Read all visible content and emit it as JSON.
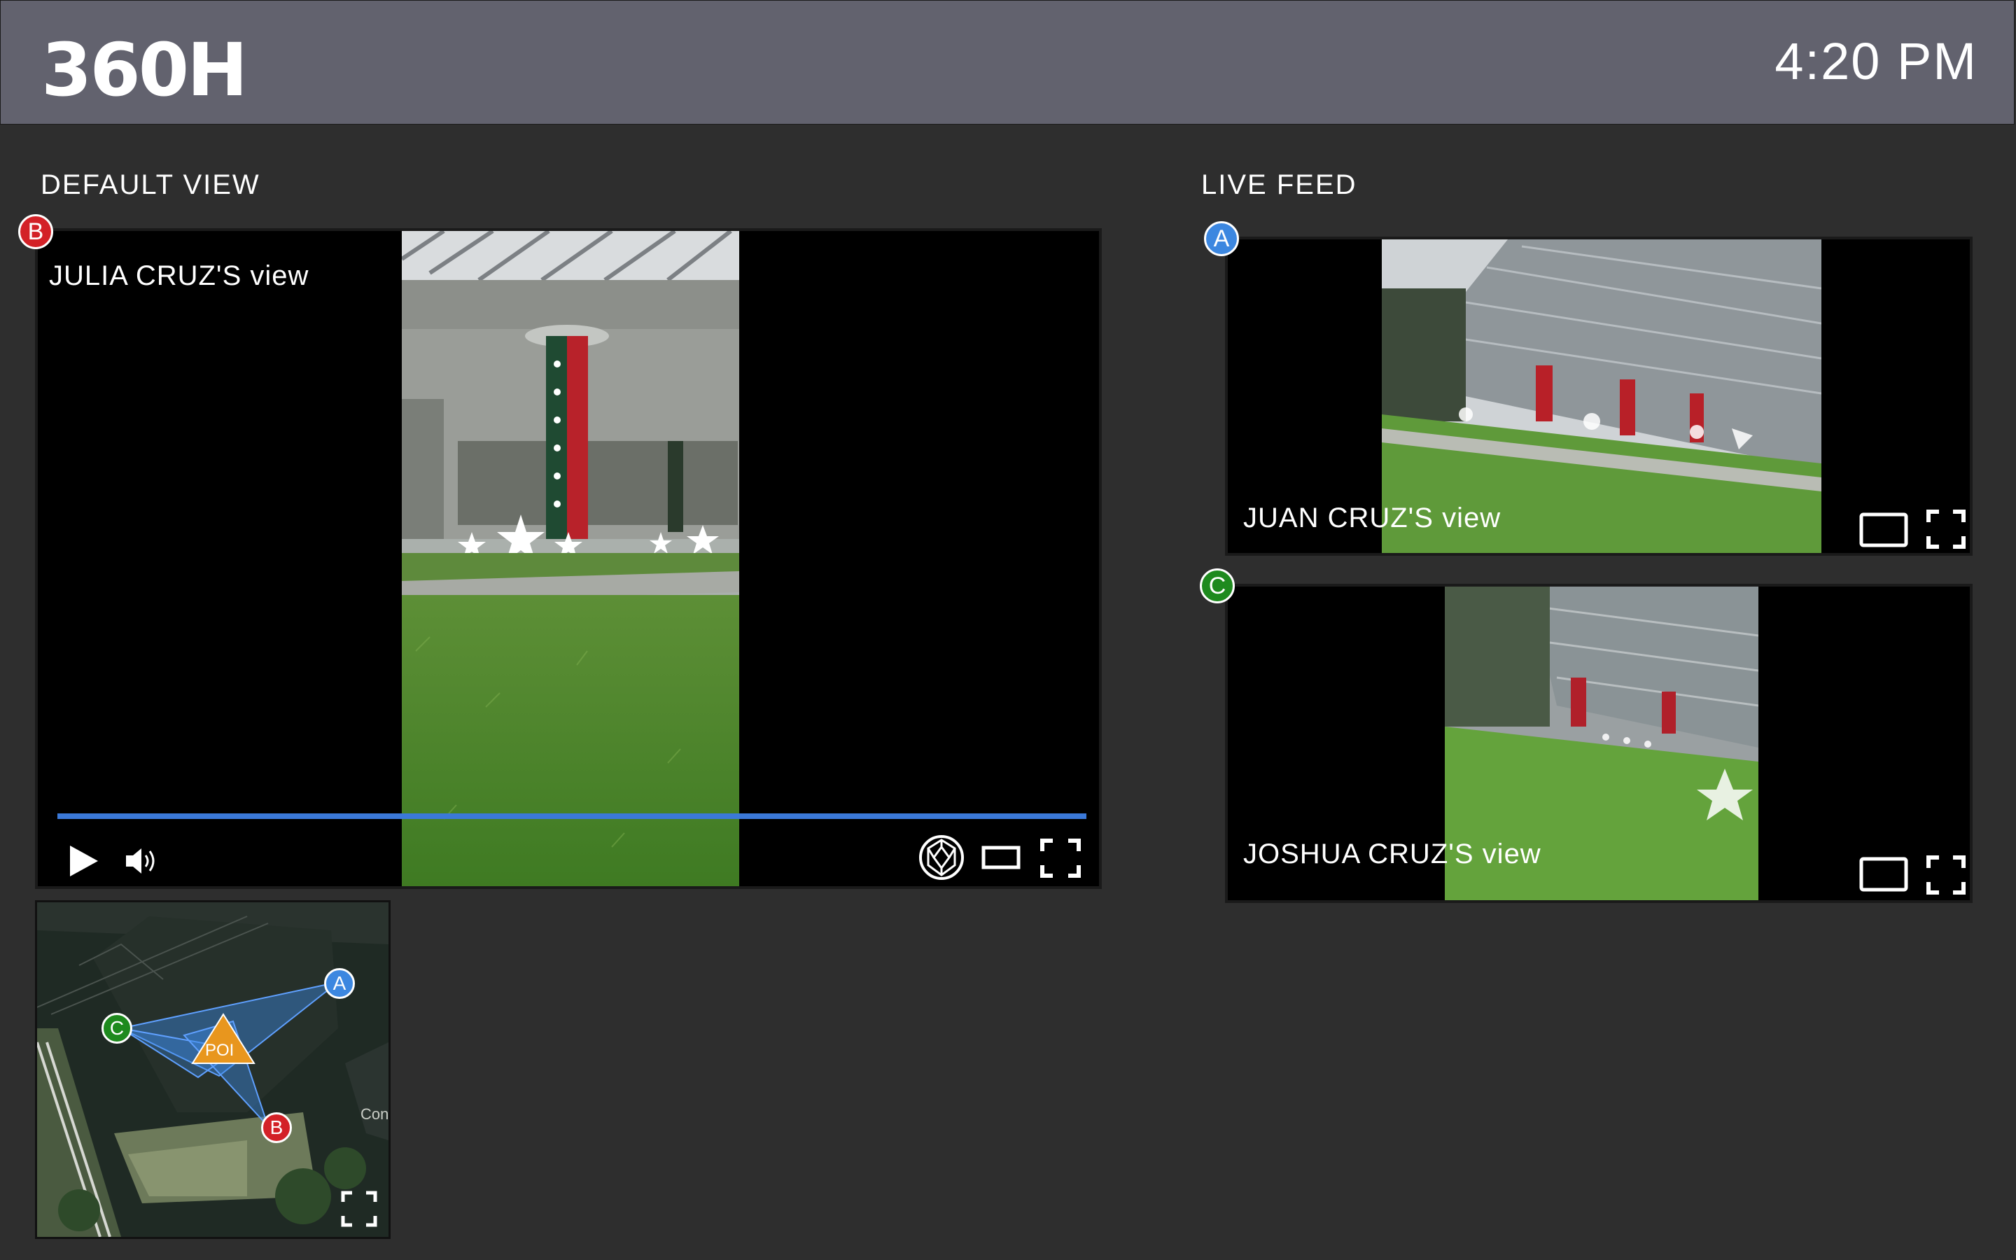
{
  "app": {
    "logo": "360H",
    "time": "4:20 PM"
  },
  "default_view": {
    "title": "DEFAULT VIEW",
    "marker": "B",
    "label": "JULIA CRUZ'S view"
  },
  "live_feed": {
    "title": "LIVE FEED",
    "feeds": [
      {
        "marker": "A",
        "label": "JUAN CRUZ'S view"
      },
      {
        "marker": "C",
        "label": "JOSHUA CRUZ'S view"
      }
    ]
  },
  "minimap": {
    "markers": [
      "A",
      "B",
      "C"
    ],
    "poi_label": "POI",
    "corner_text": "Con"
  },
  "icons": {
    "play": "play-icon",
    "volume": "volume-icon",
    "sphere": "360-sphere-icon",
    "theater": "theater-mode-icon",
    "fullscreen": "fullscreen-icon"
  },
  "colors": {
    "marker_a": "#3c87e0",
    "marker_b": "#d32127",
    "marker_c": "#1e8a1e",
    "progress": "#3b79d8",
    "poi": "#e8961e"
  }
}
